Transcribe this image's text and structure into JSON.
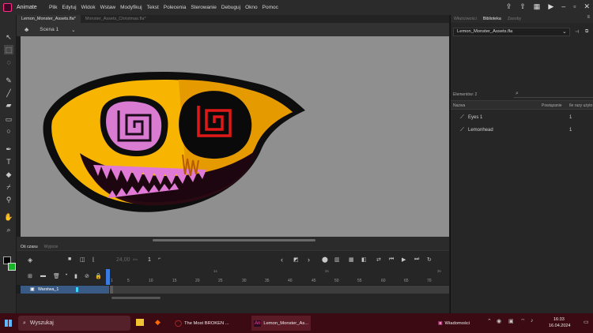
{
  "app": {
    "title": "Animate"
  },
  "menu": [
    "Plik",
    "Edytuj",
    "Widok",
    "Wstaw",
    "Modyfikuj",
    "Tekst",
    "Polecenia",
    "Sterowanie",
    "Debuguj",
    "Okno",
    "Pomoc"
  ],
  "doc_tabs": [
    {
      "label": "Lemon_Monster_Assets.fla*",
      "active": true
    },
    {
      "label": "Monster_Assets_Christmas.fla*",
      "active": false
    }
  ],
  "scene": {
    "label": "Scena 1"
  },
  "right_panel": {
    "tabs": [
      "Właściwości",
      "Biblioteka",
      "Zasoby"
    ],
    "library_file": "Lemon_Monster_Assets.fla",
    "element_count": "Elementów: 2",
    "columns": {
      "name": "Nazwa",
      "linkage": "Powiązanie",
      "use_count": "Ile razy użyto"
    },
    "items": [
      {
        "name": "Eyes 1",
        "count": "1"
      },
      {
        "name": "Lemonhead",
        "count": "1"
      }
    ]
  },
  "timeline": {
    "tabs": [
      "Oś czasu",
      "Wyjście"
    ],
    "fps": "24,00",
    "fps_unit": "kl/s",
    "frame": "1",
    "layer_name": "Warstwa_1",
    "seconds": [
      "1s",
      "2s",
      "3s"
    ],
    "frame_numbers": [
      "1",
      "5",
      "10",
      "15",
      "20",
      "25",
      "30",
      "35",
      "40",
      "45",
      "50",
      "55",
      "60",
      "65",
      "70"
    ]
  },
  "taskbar": {
    "search": "Wyszukaj",
    "tasks": [
      "The Most BROKEN ...",
      "Lemon_Monster_As..."
    ],
    "news": "Wiadomości",
    "time": "16:33",
    "date": "16.04.2024"
  },
  "colors": {
    "stage": "#8f8f8f",
    "accent": "#3a5a86",
    "taskbar": "#3b0a12"
  }
}
